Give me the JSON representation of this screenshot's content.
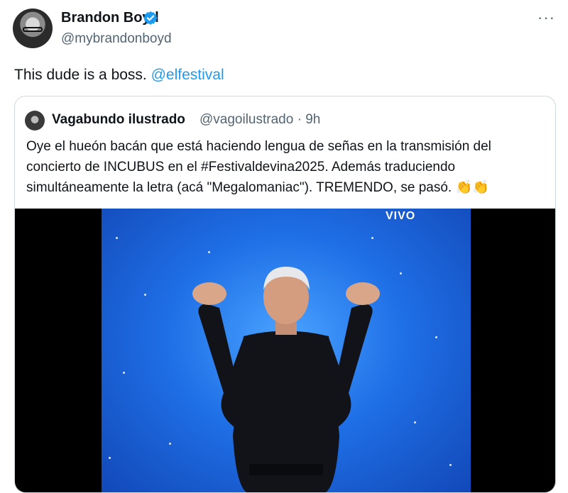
{
  "tweet": {
    "author_name": "Brandon Boyd",
    "author_handle": "@mybrandonboyd",
    "more_label": "···",
    "text": "This dude is a boss.",
    "mention": "@elfestival"
  },
  "quoted": {
    "author_name": "Vagabundo ilustrado",
    "author_handle": "@vagoilustrado · 9h",
    "text": "Oye el hueón bacán que está haciendo lengua de señas en la transmisión del concierto de INCUBUS en el #Festivaldevina2025. Además traduciendo simultáneamente la letra (acá \"Megalomaniac\"). TREMENDO, se pasó. 👏👏",
    "video_overlay": "VIVO"
  },
  "colors": {
    "accent": "#1d9bf0",
    "secondary_text": "#536471",
    "border": "#cfd9de",
    "stage_blue": "#1f6fe6"
  },
  "icons": [
    "verified-badge-icon",
    "more-options-icon"
  ]
}
